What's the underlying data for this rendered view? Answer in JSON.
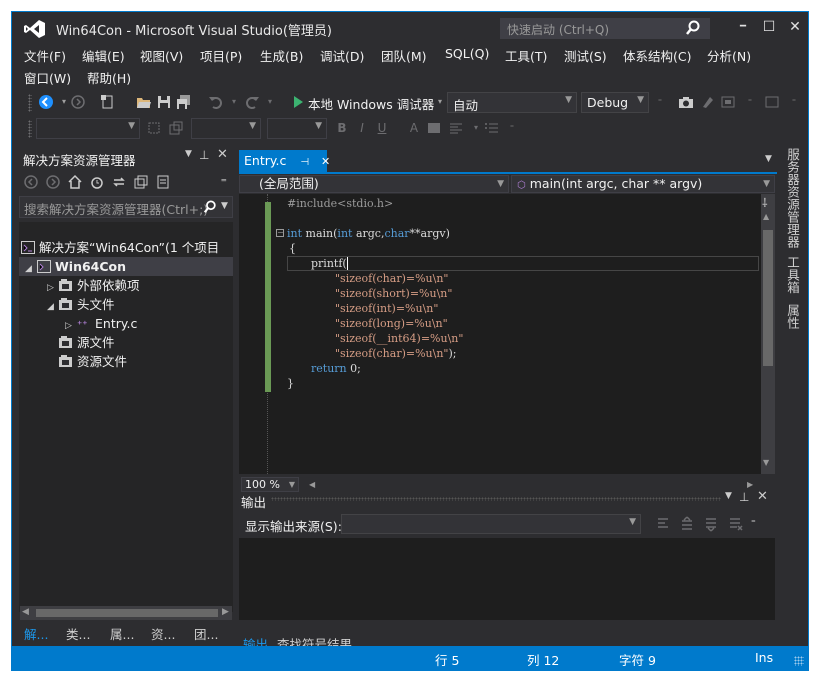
{
  "window": {
    "title": "Win64Con - Microsoft Visual Studio(管理员)",
    "quick_launch_placeholder": "快速启动 (Ctrl+Q)",
    "minimize": "━",
    "restore": "☐",
    "close": "✕"
  },
  "menu": {
    "items": [
      "文件(F)",
      "编辑(E)",
      "视图(V)",
      "项目(P)",
      "生成(B)",
      "调试(D)",
      "团队(M)",
      "SQL(Q)",
      "工具(T)",
      "测试(S)",
      "体系结构(C)",
      "分析(N)",
      "窗口(W)",
      "帮助(H)"
    ]
  },
  "toolbar": {
    "start_label": "本地 Windows 调试器",
    "config_mode": "自动",
    "configuration": "Debug"
  },
  "solution_explorer": {
    "title": "解决方案资源管理器",
    "search_placeholder": "搜索解决方案资源管理器(Ctrl+;)",
    "nodes": [
      {
        "label": "解决方案“Win64Con”(1 个项目"
      },
      {
        "label": "Win64Con"
      },
      {
        "label": "外部依赖项"
      },
      {
        "label": "头文件"
      },
      {
        "label": "Entry.c"
      },
      {
        "label": "源文件"
      },
      {
        "label": "资源文件"
      }
    ],
    "bottom_tabs": [
      "解...",
      "类...",
      "属...",
      "资...",
      "团..."
    ]
  },
  "editor": {
    "tab_label": "Entry.c",
    "scope": "(全局范围)",
    "member": "main(int argc, char ** argv)",
    "zoom": "100 %"
  },
  "code": {
    "line1": "#include<stdio.h>",
    "line3_kw": "int",
    "line3_a": " main(",
    "line3_kw2": "int",
    "line3_b": " argc,",
    "line3_kw3": "char",
    "line3_c": "**argv)",
    "line4": "{",
    "line5": "printf(",
    "s1": "\"sizeof(char)=%u\\n\"",
    "s2": "\"sizeof(short)=%u\\n\"",
    "s3": "\"sizeof(int)=%u\\n\"",
    "s4": "\"sizeof(long)=%u\\n\"",
    "s5": "\"sizeof(__int64)=%u\\n\"",
    "s6": "\"sizeof(char)=%u\\n\"",
    "s6_end": ");",
    "ret_kw": "return",
    "ret_val": " 0;",
    "line_close": "}"
  },
  "output": {
    "title": "输出",
    "source_label": "显示输出来源(S):",
    "tabs": [
      "输出",
      "查找符号结果"
    ]
  },
  "side_tabs": [
    "服务器资源管理器",
    "工具箱",
    "属性"
  ],
  "status": {
    "line": "行 5",
    "col": "列 12",
    "char": "字符 9",
    "mode": "Ins"
  }
}
